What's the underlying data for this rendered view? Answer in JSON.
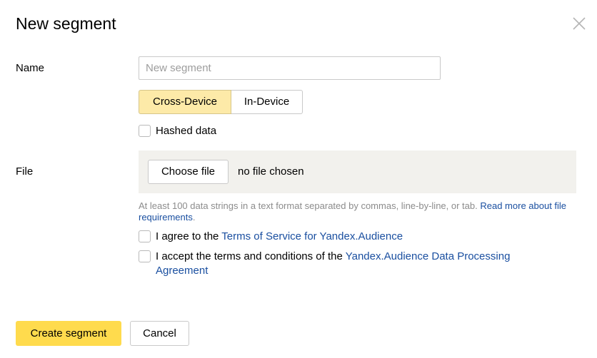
{
  "dialog": {
    "title": "New segment"
  },
  "name_field": {
    "label": "Name",
    "placeholder": "New segment",
    "value": ""
  },
  "device_toggle": {
    "options": [
      "Cross-Device",
      "In-Device"
    ],
    "selected": "Cross-Device"
  },
  "hashed": {
    "label": "Hashed data",
    "checked": false
  },
  "file_field": {
    "label": "File",
    "button": "Choose file",
    "status": "no file chosen",
    "hint": "At least 100 data strings in a text format separated by commas, line-by-line, or tab.",
    "hint_link": "Read more about file requirements",
    "hint_end": "."
  },
  "agreements": {
    "tos_prefix": "I agree to the ",
    "tos_link": "Terms of Service for Yandex.Audience",
    "tos_checked": false,
    "dpa_prefix": "I accept the terms and conditions of the ",
    "dpa_link": "Yandex.Audience Data Processing Agreement",
    "dpa_checked": false
  },
  "actions": {
    "create": "Create segment",
    "cancel": "Cancel"
  },
  "colors": {
    "accent_button": "#ffdb4d",
    "selected_toggle": "#fdeaa8",
    "link": "#1a4fa0",
    "file_area": "#f2f1ed"
  },
  "icons": {
    "close": "close-icon"
  }
}
